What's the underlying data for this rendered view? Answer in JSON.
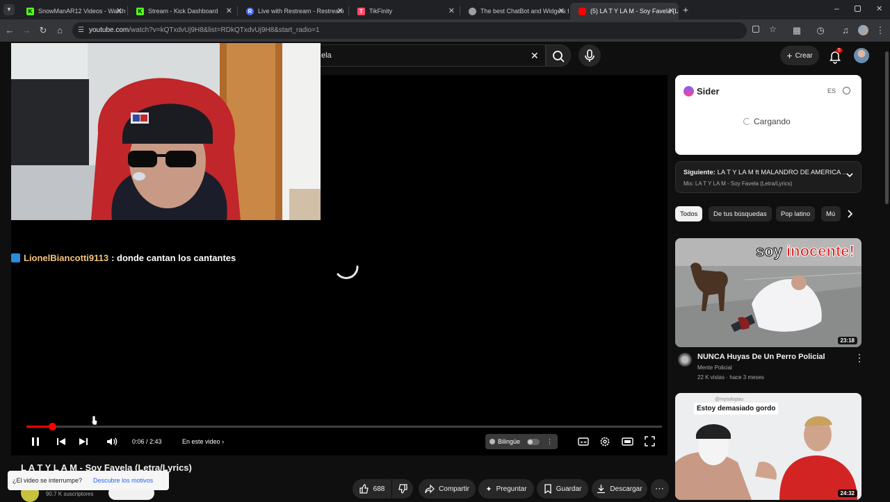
{
  "browser": {
    "tabs": [
      {
        "title": "SnowManAR12 Videos - Watch",
        "favicon_color": "#53fc18",
        "favicon_letter": "K"
      },
      {
        "title": "Stream - Kick Dashboard",
        "favicon_color": "#53fc18",
        "favicon_letter": "K"
      },
      {
        "title": "Live with Restream - Restream",
        "favicon_color": "#4a6cf7",
        "favicon_letter": "R"
      },
      {
        "title": "TikFinity",
        "favicon_color": "#ff4d6d",
        "favicon_letter": "T"
      },
      {
        "title": "The best ChatBot and Widgets f",
        "favicon_color": "#9aa0a6",
        "favicon_letter": ""
      },
      {
        "title": "(5) LA T Y LA M - Soy Favela (Le",
        "favicon_color": "#ff0000",
        "favicon_letter": ""
      }
    ],
    "url_host": "youtube.com",
    "url_rest": "/watch?v=kQTxdvUj9H8&list=RDkQTxdvUj9H8&start_radio=1"
  },
  "header": {
    "search_query": "ela",
    "create_label": "Crear",
    "notification_count": "5"
  },
  "player": {
    "chat_user": "LionelBiancotti9113",
    "chat_message": ": donde cantan los cantantes",
    "time_current": "0:06",
    "time_total": "2:43",
    "time_display": "0:06 / 2:43",
    "chapter_label": "En este video",
    "bilingual_label": "Bilingüe",
    "progress_fraction": 0.04
  },
  "video": {
    "title": "L A T Y L A M - Soy Favela (Letra/Lyrics)",
    "subscribers": "90.7 K suscriptores",
    "likes": "688",
    "share_label": "Compartir",
    "ask_label": "Preguntar",
    "save_label": "Guardar",
    "download_label": "Descargar"
  },
  "toast": {
    "question": "¿El video se interrumpe?",
    "link": "Descubre los motivos"
  },
  "sidebar": {
    "sider": {
      "brand": "Sider",
      "lang": "ES",
      "loading": "Cargando"
    },
    "next": {
      "label": "Siguiente:",
      "title": "LA T Y LA M ft MALANDRO DE AMERICA ...",
      "mix": "Mix: LA T Y LA M - Soy Favela (Letra/Lyrics)"
    },
    "chips": [
      "Todos",
      "De tus búsquedas",
      "Pop latino",
      "Mú"
    ],
    "videos": [
      {
        "overlay_text_1": "soy",
        "overlay_text_2": "inocente!",
        "duration": "23:18",
        "title": "NUNCA Huyas De Un Perro Policial",
        "channel": "Mente Policial",
        "meta": "22 K vistas · hace 3 meses"
      },
      {
        "overlay_handle": "@mysolopau",
        "overlay_text": "Estoy demasiado gordo",
        "duration": "24:32"
      }
    ]
  }
}
